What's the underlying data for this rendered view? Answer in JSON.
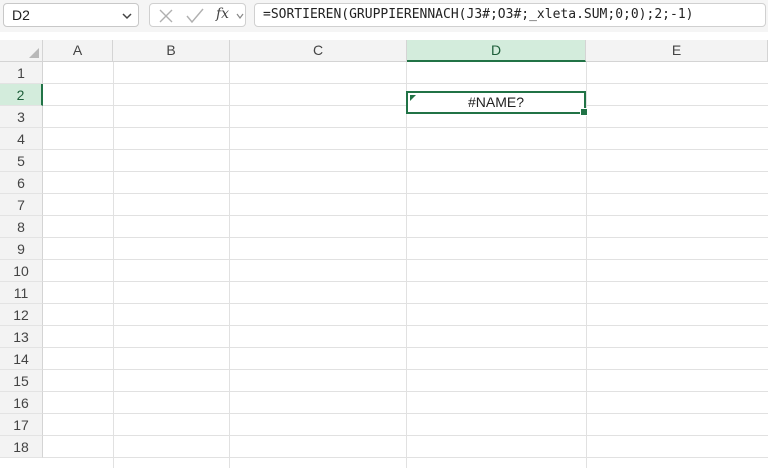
{
  "formula_bar": {
    "name_box": "D2",
    "fx_label": "fx",
    "formula": "=SORTIEREN(GRUPPIERENNACH(J3#;O3#;_xleta.SUM;0;0);2;-1)"
  },
  "grid": {
    "columns": [
      "A",
      "B",
      "C",
      "D",
      "E"
    ],
    "selected_column": "D",
    "rows": [
      "1",
      "2",
      "3",
      "4",
      "5",
      "6",
      "7",
      "8",
      "9",
      "10",
      "11",
      "12",
      "13",
      "14",
      "15",
      "16",
      "17",
      "18"
    ],
    "selected_row": "2",
    "active_cell": {
      "ref": "D2",
      "value": "#NAME?"
    }
  },
  "colors": {
    "accent": "#217346",
    "selected_header_bg": "#d3ecdc"
  }
}
